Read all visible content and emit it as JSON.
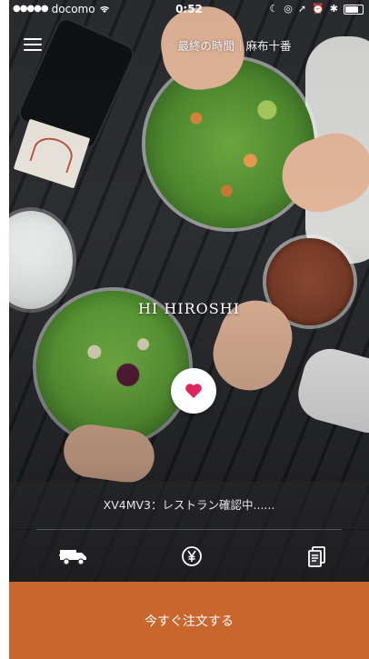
{
  "status_bar": {
    "carrier": "docomo",
    "time": "0:52"
  },
  "header": {
    "title": "最終の時間｜麻布十番"
  },
  "hero": {
    "greeting": "HI HIROSHI"
  },
  "info": {
    "status_text": "XV4MV3：レストラン確認中......"
  },
  "order": {
    "button_label": "今すぐ注文する"
  },
  "icons": {
    "menu": "hamburger-menu-icon",
    "favorite": "heart-icon",
    "delivery": "delivery-truck-icon",
    "price": "yen-coin-icon",
    "receipt": "receipt-document-icon"
  },
  "colors": {
    "order_button": "#c9662d",
    "heart": "#e0245e",
    "info_bar": "#28282a"
  }
}
